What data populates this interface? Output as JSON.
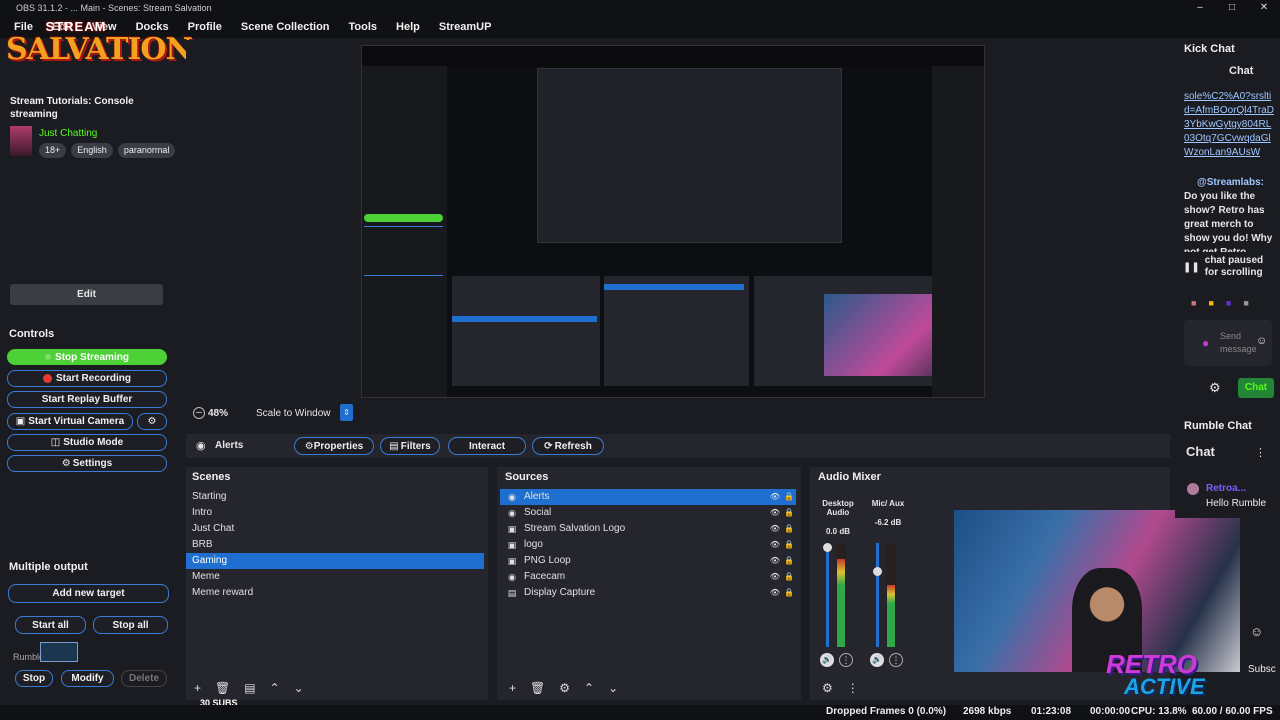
{
  "window": {
    "title": "OBS 31.1.2 - ... Main - Scenes: Stream Salvation"
  },
  "menu": [
    "File",
    "Edit",
    "View",
    "Docks",
    "Profile",
    "Scene Collection",
    "Tools",
    "Help",
    "StreamUP"
  ],
  "stream_info": {
    "logo_top": "STREAM",
    "logo_main": "SALVATION",
    "title": "Stream Tutorials: Console streaming",
    "category": "Just Chatting",
    "tags": [
      "18+",
      "English",
      "paranormal"
    ],
    "edit_label": "Edit"
  },
  "controls": {
    "title": "Controls",
    "stop_streaming": "Stop Streaming",
    "start_recording": "Start Recording",
    "start_replay": "Start Replay Buffer",
    "start_virtual_camera": "Start Virtual Camera",
    "studio_mode": "Studio Mode",
    "settings": "Settings"
  },
  "multiple_output": {
    "title": "Multiple output",
    "add_target": "Add new target",
    "start_all": "Start all",
    "stop_all": "Stop all",
    "target_name": "Rumble",
    "stop": "Stop",
    "modify": "Modify",
    "delete": "Delete"
  },
  "preview": {
    "zoom": "48%",
    "scale_mode": "Scale to Window"
  },
  "source_toolbar": {
    "source_name": "Alerts",
    "properties": "Properties",
    "filters": "Filters",
    "interact": "Interact",
    "refresh": "Refresh"
  },
  "scenes": {
    "title": "Scenes",
    "items": [
      "Starting",
      "Intro",
      "Just Chat",
      "BRB",
      "Gaming",
      "Meme",
      "Meme reward"
    ],
    "selected": "Gaming"
  },
  "sources": {
    "title": "Sources",
    "items": [
      "Alerts",
      "Social",
      "Stream Salvation Logo",
      "logo",
      "PNG Loop",
      "Facecam",
      "Display Capture"
    ],
    "selected": "Alerts"
  },
  "audio_mixer": {
    "title": "Audio Mixer",
    "channels": [
      {
        "name": "Desktop Audio",
        "db": "0.0 dB",
        "level": 0.85
      },
      {
        "name": "Mic/ Aux",
        "db": "-6.2 dB",
        "level": 0.6
      }
    ]
  },
  "kick_chat": {
    "dock_title": "Kick Chat",
    "header": "Chat",
    "link_text": "sole%C2%A0?srsltid=AfmBOorQl4TraD3YbKwGytgy804RL03Otq7GCvwqdaGlWzonLan9AUsW",
    "author": "@Streamlabs:",
    "message": "Do you like the show? Retro has great merch to show you do! Why not get Retro",
    "paused": "chat paused for scrolling",
    "send_placeholder": "Send message",
    "chat_button": "Chat"
  },
  "rumble_chat": {
    "dock_title": "Rumble Chat",
    "header": "Chat",
    "user": "Retroa...",
    "message": "Hello Rumble",
    "subscribe": "Subsc"
  },
  "overlay": {
    "retro_line1": "RETRO",
    "retro_line2": "ACTIVE",
    "subs_count": "30 SUBS"
  },
  "status": {
    "dropped": "Dropped Frames 0 (0.0%)",
    "bitrate": "2698 kbps",
    "stream_time": "01:23:08",
    "rec_time": "00:00:00",
    "cpu": "CPU: 13.8%",
    "fps": "60.00 / 60.00 FPS"
  },
  "colors": {
    "accent": "#1f6fd0",
    "stream_on": "#4cd137",
    "outline": "#3a7bd5",
    "rec": "#e53935"
  }
}
